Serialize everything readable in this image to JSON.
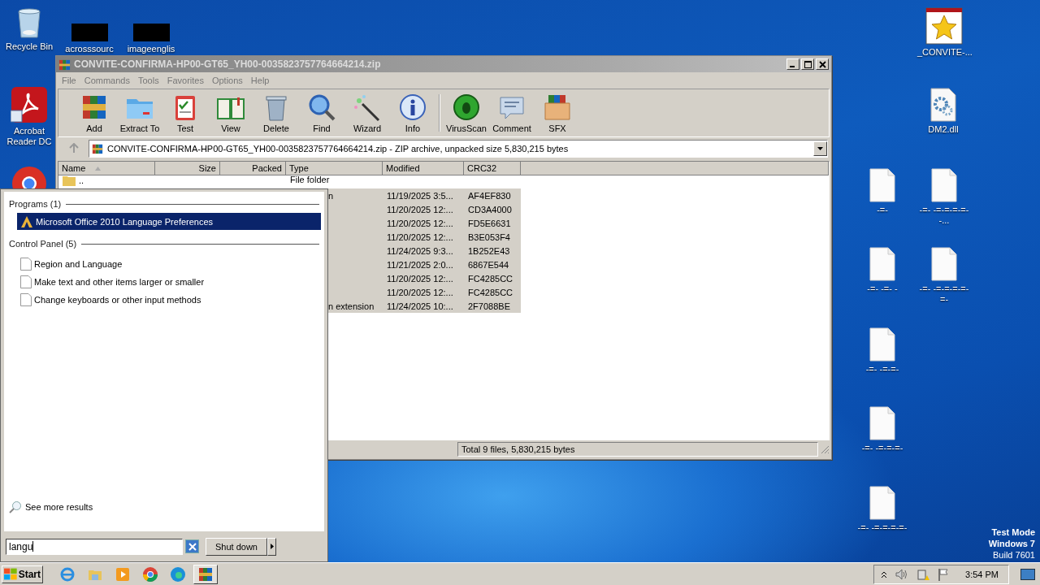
{
  "desktop_icons": [
    {
      "kind": "recycle-bin",
      "label": "Recycle Bin"
    },
    {
      "kind": "redacted",
      "label": "acrosssourc"
    },
    {
      "kind": "redacted",
      "label": "imageenglis"
    },
    {
      "kind": "acrobat",
      "label": "Acrobat Reader DC"
    },
    {
      "kind": "chrome"
    },
    {
      "kind": "star",
      "label": "_CONVITE-..."
    },
    {
      "kind": "dll",
      "label": "DM2.dll"
    },
    {
      "kind": "blank",
      "label": "-=-"
    },
    {
      "kind": "blank",
      "label": "-=- -=-=-=-=--..."
    },
    {
      "kind": "blank",
      "label": "-=- -=- -"
    },
    {
      "kind": "blank",
      "label": "-=- -=-=-=-=-=-"
    },
    {
      "kind": "blank",
      "label": "-=- -=-=-"
    },
    {
      "kind": "blank",
      "label": "-=- -=-=-=-"
    },
    {
      "kind": "blank",
      "label": "-=- -=-=-=-=-"
    }
  ],
  "window": {
    "title": "CONVITE-CONFIRMA-HP00-GT65_YH00-0035823757764664214.zip",
    "menu": [
      "File",
      "Commands",
      "Tools",
      "Favorites",
      "Options",
      "Help"
    ],
    "toolbar": [
      {
        "kind": "add",
        "label": "Add"
      },
      {
        "kind": "extract",
        "label": "Extract To"
      },
      {
        "kind": "test",
        "label": "Test"
      },
      {
        "kind": "view",
        "label": "View"
      },
      {
        "kind": "delete",
        "label": "Delete"
      },
      {
        "kind": "find",
        "label": "Find"
      },
      {
        "kind": "wizard",
        "label": "Wizard"
      },
      {
        "kind": "info",
        "label": "Info"
      },
      {
        "kind": "separator"
      },
      {
        "kind": "virusscan",
        "label": "VirusScan"
      },
      {
        "kind": "comment",
        "label": "Comment"
      },
      {
        "kind": "sfx",
        "label": "SFX"
      }
    ],
    "address": "CONVITE-CONFIRMA-HP00-GT65_YH00-0035823757764664214.zip - ZIP archive, unpacked size 5,830,215 bytes",
    "columns": [
      "Name",
      "Size",
      "Packed",
      "Type",
      "Modified",
      "CRC32"
    ],
    "rows": [
      {
        "kind": "folder",
        "name": "..",
        "type": "File folder",
        "modified": "",
        "crc": "",
        "selected": false
      },
      {
        "kind": "file",
        "type": "n",
        "modified": "11/19/2025 3:5...",
        "crc": "AF4EF830",
        "selected": true
      },
      {
        "kind": "file",
        "modified": "11/20/2025 12:...",
        "crc": "CD3A4000",
        "selected": true
      },
      {
        "kind": "file",
        "modified": "11/20/2025 12:...",
        "crc": "FD5E6631",
        "selected": true
      },
      {
        "kind": "file",
        "modified": "11/20/2025 12:...",
        "crc": "B3E053F4",
        "selected": true
      },
      {
        "kind": "file",
        "modified": "11/24/2025 9:3...",
        "crc": "1B252E43",
        "selected": true
      },
      {
        "kind": "file",
        "modified": "11/21/2025 2:0...",
        "crc": "6867E544",
        "selected": true
      },
      {
        "kind": "file",
        "modified": "11/20/2025 12:...",
        "crc": "FC4285CC",
        "selected": true
      },
      {
        "kind": "file",
        "modified": "11/20/2025 12:...",
        "crc": "FC4285CC",
        "selected": true
      },
      {
        "kind": "file",
        "type": "n extension",
        "modified": "11/24/2025 10:...",
        "crc": "2F7088BE",
        "selected": true
      }
    ],
    "status": "Total 9 files, 5,830,215 bytes"
  },
  "start_menu": {
    "groups": [
      {
        "heading": "Programs (1)",
        "items": [
          {
            "kind": "office",
            "label": "Microsoft Office 2010 Language Preferences",
            "selected": true
          }
        ]
      },
      {
        "heading": "Control Panel (5)",
        "items": [
          {
            "kind": "page",
            "label": "Region and Language",
            "selected": false
          },
          {
            "kind": "page",
            "label": "Make text and other items larger or smaller",
            "selected": false
          },
          {
            "kind": "page",
            "label": "Change keyboards or other input methods",
            "selected": false
          }
        ]
      }
    ],
    "more": "See more results",
    "search": {
      "value": "langu"
    },
    "shutdown": "Shut down"
  },
  "taskbar": {
    "start": "Start",
    "apps": [
      {
        "kind": "ie",
        "selected": false
      },
      {
        "kind": "explorer",
        "selected": false
      },
      {
        "kind": "media",
        "selected": false
      },
      {
        "kind": "chrome",
        "selected": false
      },
      {
        "kind": "edge",
        "selected": false
      },
      {
        "kind": "winrar",
        "selected": true
      }
    ],
    "clock": "3:54 PM"
  },
  "watermark_os": [
    "Test Mode",
    "Windows 7",
    "Build 7601"
  ]
}
